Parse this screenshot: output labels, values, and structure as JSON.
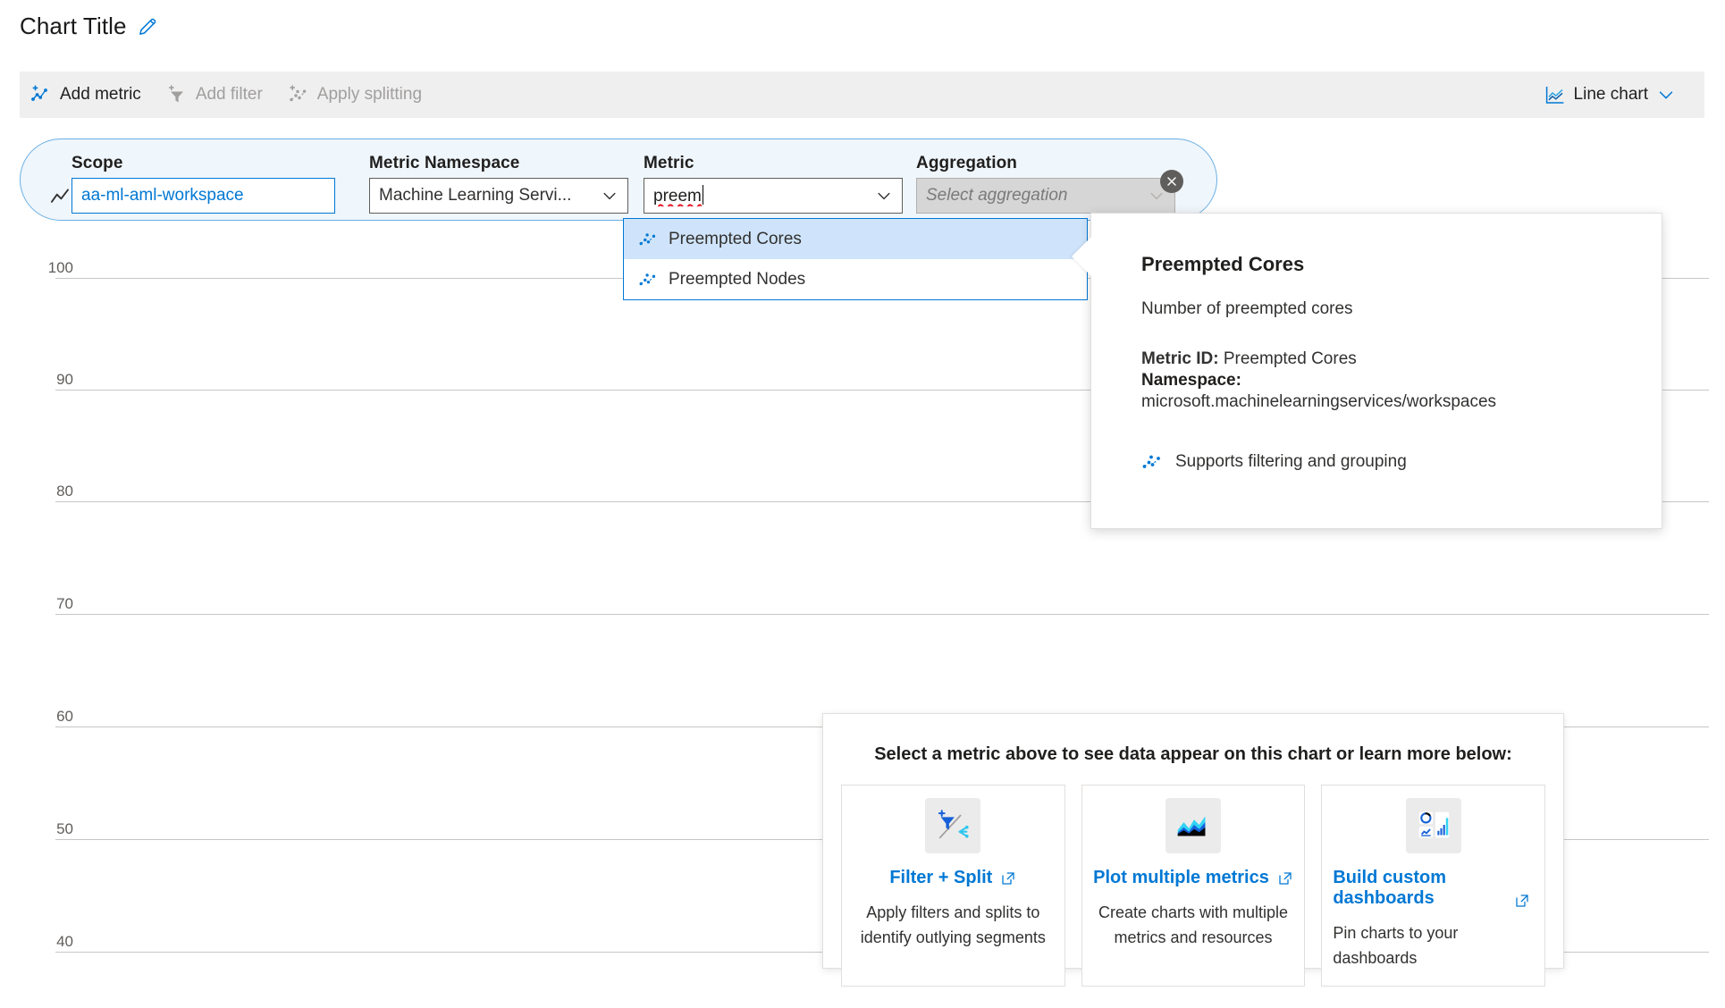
{
  "header": {
    "chart_title": "Chart Title",
    "edit_icon": "pencil-icon"
  },
  "toolbar": {
    "add_metric": "Add metric",
    "add_filter": "Add filter",
    "apply_splitting": "Apply splitting",
    "chart_type": "Line chart"
  },
  "metric_selector": {
    "scope_label": "Scope",
    "scope_value": "aa-ml-aml-workspace",
    "namespace_label": "Metric Namespace",
    "namespace_value": "Machine Learning Servi...",
    "metric_label": "Metric",
    "metric_value": "preem",
    "aggregation_label": "Aggregation",
    "aggregation_placeholder": "Select aggregation",
    "remove_label": "Remove metric"
  },
  "metric_dropdown": {
    "options": [
      {
        "label": "Preempted Cores",
        "selected": true
      },
      {
        "label": "Preempted Nodes",
        "selected": false
      }
    ]
  },
  "metric_info": {
    "title": "Preempted Cores",
    "description": "Number of preempted cores",
    "metric_id_label": "Metric ID:",
    "metric_id_value": "Preempted Cores",
    "namespace_label": "Namespace:",
    "namespace_value": "microsoft.machinelearningservices/workspaces",
    "supports_note": "Supports filtering and grouping"
  },
  "empty_state": {
    "heading": "Select a metric above to see data appear on this chart or learn more below:",
    "cards": [
      {
        "icon": "filter-split-icon",
        "link": "Filter + Split",
        "desc": "Apply filters and splits to identify outlying segments"
      },
      {
        "icon": "multi-metrics-chart-icon",
        "link": "Plot multiple metrics",
        "desc": "Create charts with multiple metrics and resources"
      },
      {
        "icon": "dashboard-icon",
        "link": "Build custom dashboards",
        "desc": "Pin charts to your dashboards"
      }
    ]
  },
  "colors": {
    "accent": "#0078d4",
    "command_bar_bg": "#efeff0",
    "pill_bg": "#eff6fc",
    "pill_border": "#69afe5",
    "gridline": "#c8c6c4",
    "spell_error": "#e81123"
  },
  "chart_data": {
    "type": "line",
    "title": "Chart Title",
    "series": [],
    "x": [],
    "xlabel": "",
    "ylabel": "",
    "yticks": [
      100,
      90,
      80,
      70,
      60,
      50,
      40
    ],
    "ylim": [
      40,
      100
    ],
    "grid": true,
    "legend": false,
    "empty": true,
    "empty_message": "Select a metric above to see data appear on this chart or learn more below:"
  }
}
